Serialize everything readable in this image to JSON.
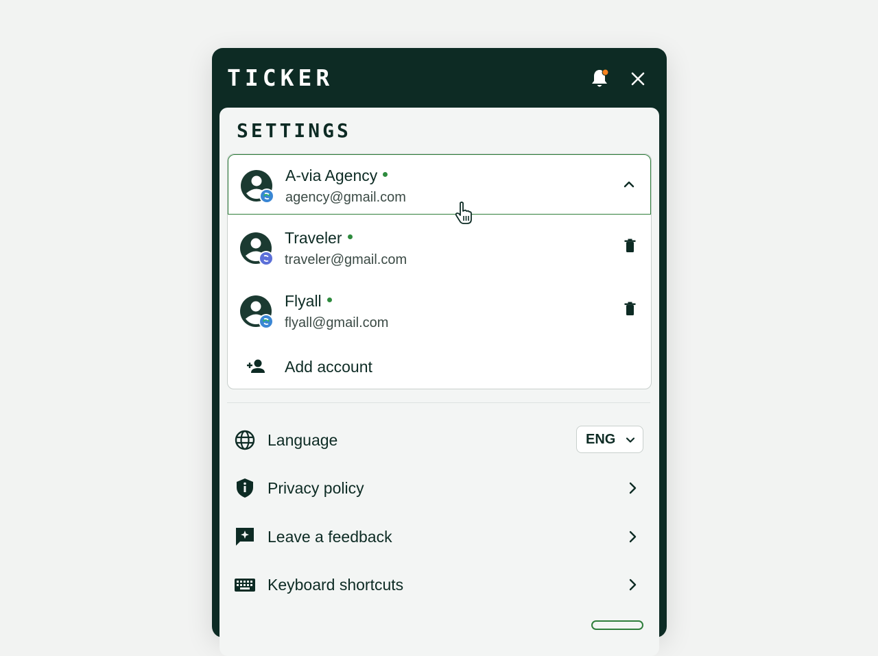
{
  "app": {
    "logo": "TICKER"
  },
  "header": {
    "notification_icon": "bell-icon",
    "close_icon": "close-icon",
    "notification_dot_color": "#f5821f"
  },
  "settings": {
    "title": "SETTINGS"
  },
  "accounts": {
    "items": [
      {
        "name": "A-via Agency",
        "email": "agency@gmail.com",
        "online": true,
        "expanded": true
      },
      {
        "name": "Traveler",
        "email": "traveler@gmail.com",
        "online": true
      },
      {
        "name": "Flyall",
        "email": "flyall@gmail.com",
        "online": true
      }
    ],
    "add_label": "Add account"
  },
  "menu": {
    "language": {
      "label": "Language",
      "value": "ENG"
    },
    "privacy": {
      "label": "Privacy policy"
    },
    "feedback": {
      "label": "Leave a feedback"
    },
    "shortcuts": {
      "label": "Keyboard shortcuts"
    }
  },
  "colors": {
    "brand_dark": "#0d2b24",
    "accent_green": "#2e7d3a",
    "online": "#2e8b3e"
  }
}
